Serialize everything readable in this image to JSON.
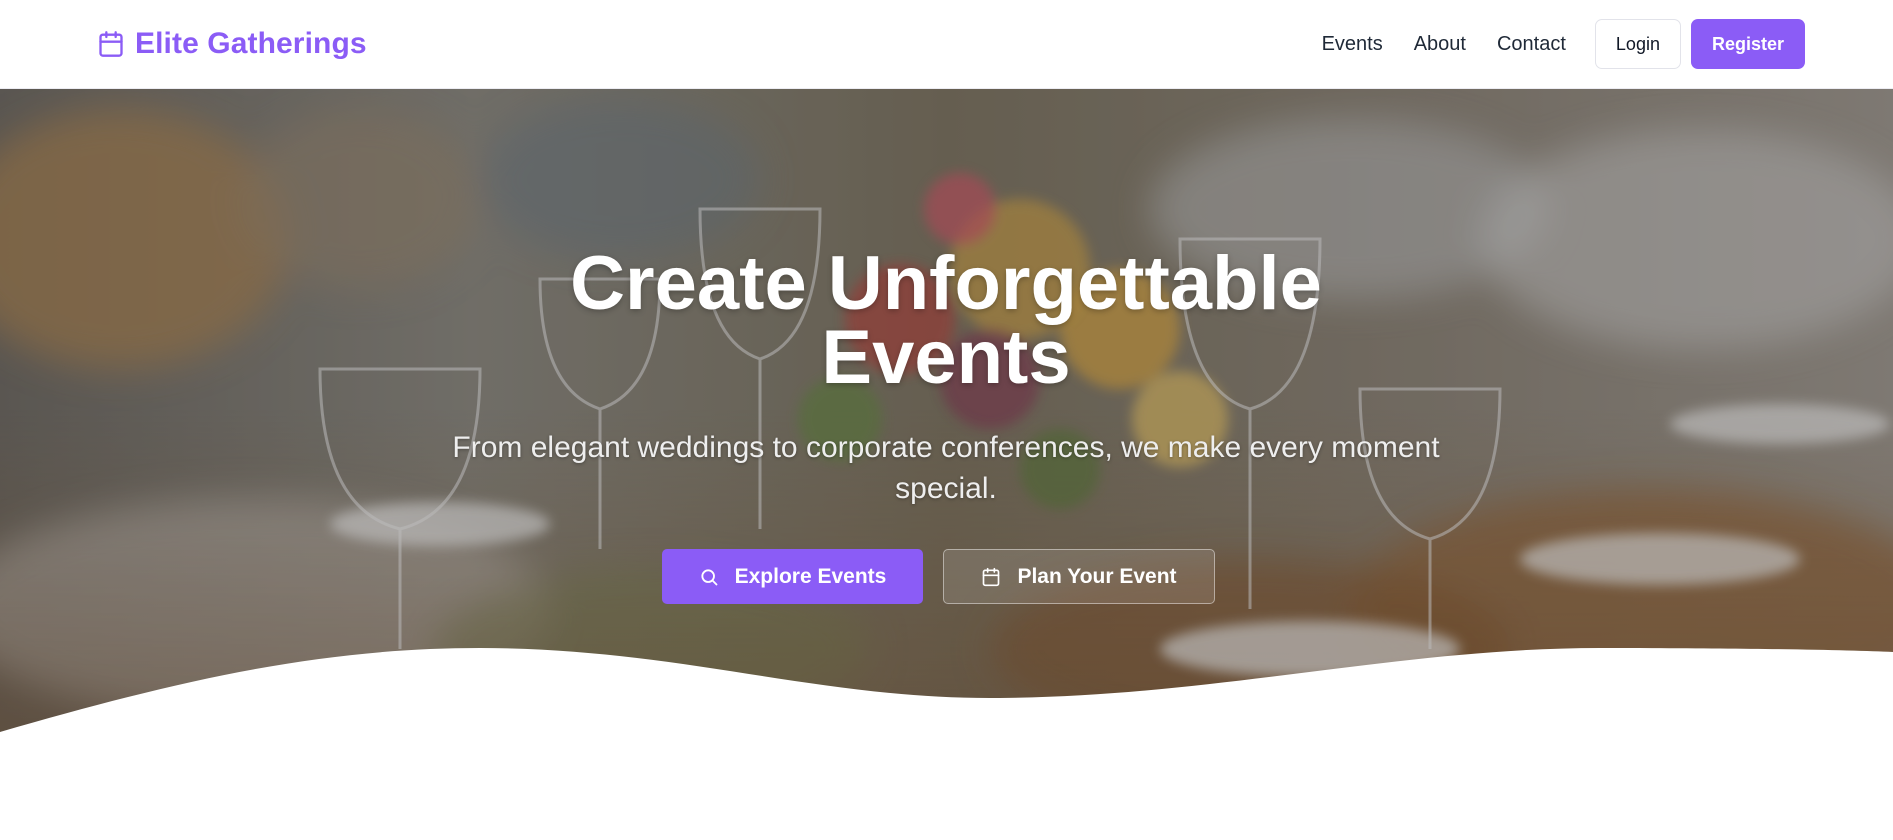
{
  "brand": {
    "name": "Elite Gatherings",
    "icon": "calendar-icon",
    "color": "#8b5cf6"
  },
  "nav": {
    "links": [
      "Events",
      "About",
      "Contact"
    ],
    "login_label": "Login",
    "register_label": "Register"
  },
  "hero": {
    "title": "Create Unforgettable Events",
    "subtitle": "From elegant weddings to corporate conferences, we make every moment special.",
    "primary_button": {
      "label": "Explore Events",
      "icon": "search-icon"
    },
    "secondary_button": {
      "label": "Plan Your Event",
      "icon": "calendar-icon"
    }
  },
  "colors": {
    "accent": "#8b5cf6",
    "text_dark": "#1f2937",
    "background": "#ffffff"
  }
}
